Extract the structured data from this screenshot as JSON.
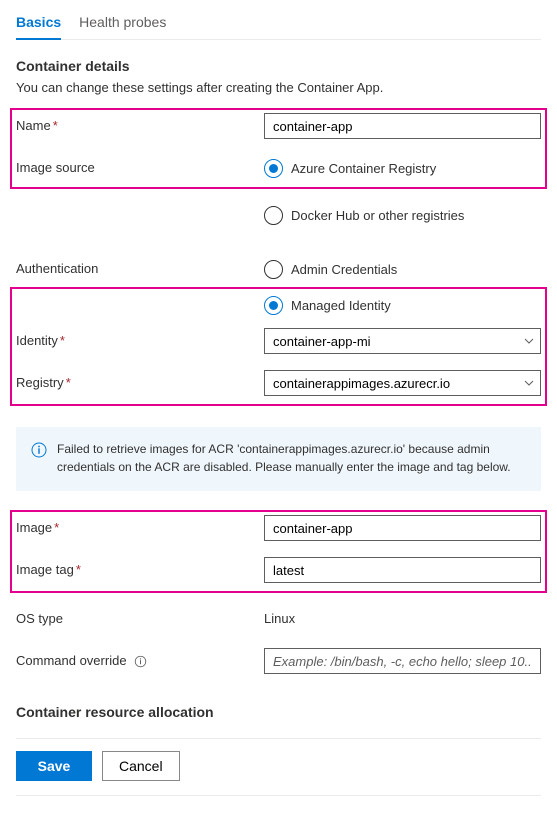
{
  "tabs": {
    "basics": "Basics",
    "health_probes": "Health probes"
  },
  "heading": "Container details",
  "description": "You can change these settings after creating the Container App.",
  "labels": {
    "name": "Name",
    "image_source": "Image source",
    "authentication": "Authentication",
    "identity": "Identity",
    "registry": "Registry",
    "image": "Image",
    "image_tag": "Image tag",
    "os_type": "OS type",
    "command_override": "Command override"
  },
  "values": {
    "name": "container-app",
    "identity": "container-app-mi",
    "registry": "containerappimages.azurecr.io",
    "image": "container-app",
    "image_tag": "latest",
    "os_type": "Linux",
    "command_override_placeholder": "Example: /bin/bash, -c, echo hello; sleep 10..."
  },
  "radios": {
    "image_source_acr": "Azure Container Registry",
    "image_source_docker": "Docker Hub or other registries",
    "auth_admin": "Admin Credentials",
    "auth_mi": "Managed Identity"
  },
  "info_message": "Failed to retrieve images for ACR 'containerappimages.azurecr.io' because admin credentials on the ACR are disabled. Please manually enter the image and tag below.",
  "resource_heading": "Container resource allocation",
  "footer": {
    "save": "Save",
    "cancel": "Cancel"
  }
}
